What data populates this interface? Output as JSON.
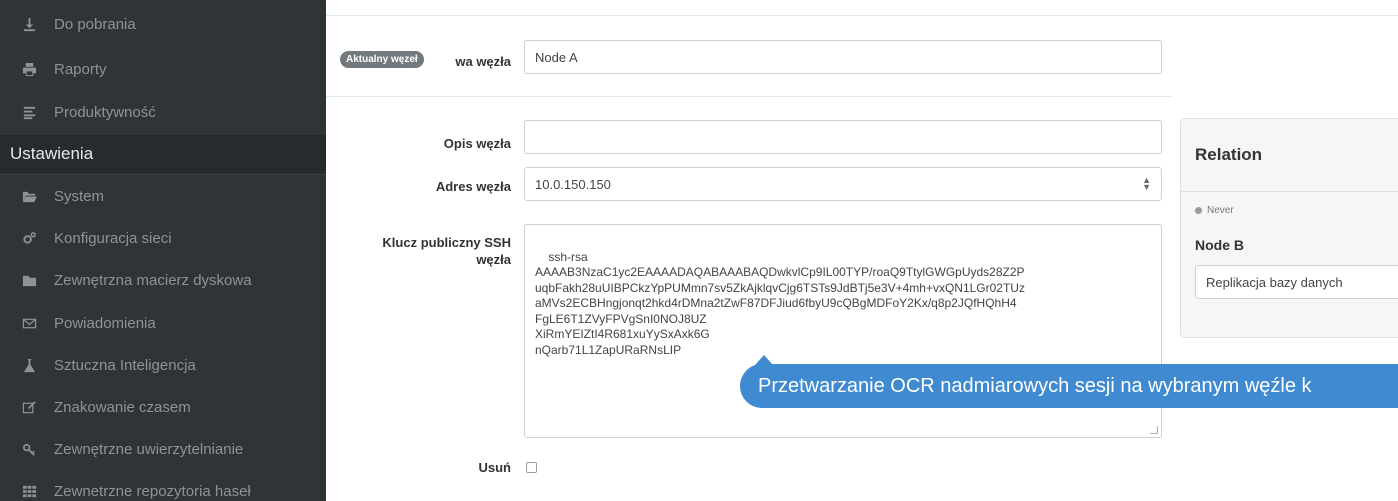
{
  "sidebar": {
    "items_top": [
      {
        "label": "Do pobrania",
        "icon": "download-icon"
      },
      {
        "label": "Raporty",
        "icon": "print-icon"
      },
      {
        "label": "Produktywność",
        "icon": "list-icon"
      }
    ],
    "section": "Ustawienia",
    "items": [
      {
        "label": "System",
        "icon": "folder-open-icon"
      },
      {
        "label": "Konfiguracja sieci",
        "icon": "cogs-icon"
      },
      {
        "label": "Zewnętrzna macierz dyskowa",
        "icon": "folder-icon"
      },
      {
        "label": "Powiadomienia",
        "icon": "envelope-icon"
      },
      {
        "label": "Sztuczna Inteligencja",
        "icon": "flask-icon"
      },
      {
        "label": "Znakowanie czasem",
        "icon": "edit-icon"
      },
      {
        "label": "Zewnętrzne uwierzytelnianie",
        "icon": "key-icon"
      },
      {
        "label": "Zewnetrzne repozytoria haseł",
        "icon": "grid-icon"
      }
    ]
  },
  "form": {
    "current_node_badge": "Aktualny węzeł",
    "name_label_visible": "wa węzła",
    "name_value": "Node A",
    "description_label": "Opis węzła",
    "description_value": "",
    "address_label": "Adres węzła",
    "address_value": "10.0.150.150",
    "ssh_label_line1": "Klucz publiczny SSH",
    "ssh_label_line2": "węzła",
    "ssh_value": "ssh-rsa\nAAAAB3NzaC1yc2EAAAADAQABAAABAQDwkvlCp9IL00TYP/roaQ9TtylGWGpUyds28Z2P\nuqbFakh28uUIBPCkzYpPUMmn7sv5ZkAjklqvCjg6TSTs9JdBTj5e3V+4mh+vxQN1LGr02TUz\naMVs2ECBHngjonqt2hkd4rDMna2tZwF87DFJiud6fbyU9cQBgMDFoY2Kx/q8p2JQfHQhH4\nFgLE6T1ZVyFPVgSnI0NOJ8UZ\nXiRmYEIZtI4R681xuYySxAxk6G\nnQarb71L1ZapURaRNsLIP",
    "delete_label": "Usuń"
  },
  "relation": {
    "title": "Relation",
    "status": "Never",
    "node": "Node B",
    "mode": "Replikacja bazy danych"
  },
  "tooltip": {
    "text": "Przetwarzanie OCR nadmiarowych sesji na wybranym węźle k"
  }
}
